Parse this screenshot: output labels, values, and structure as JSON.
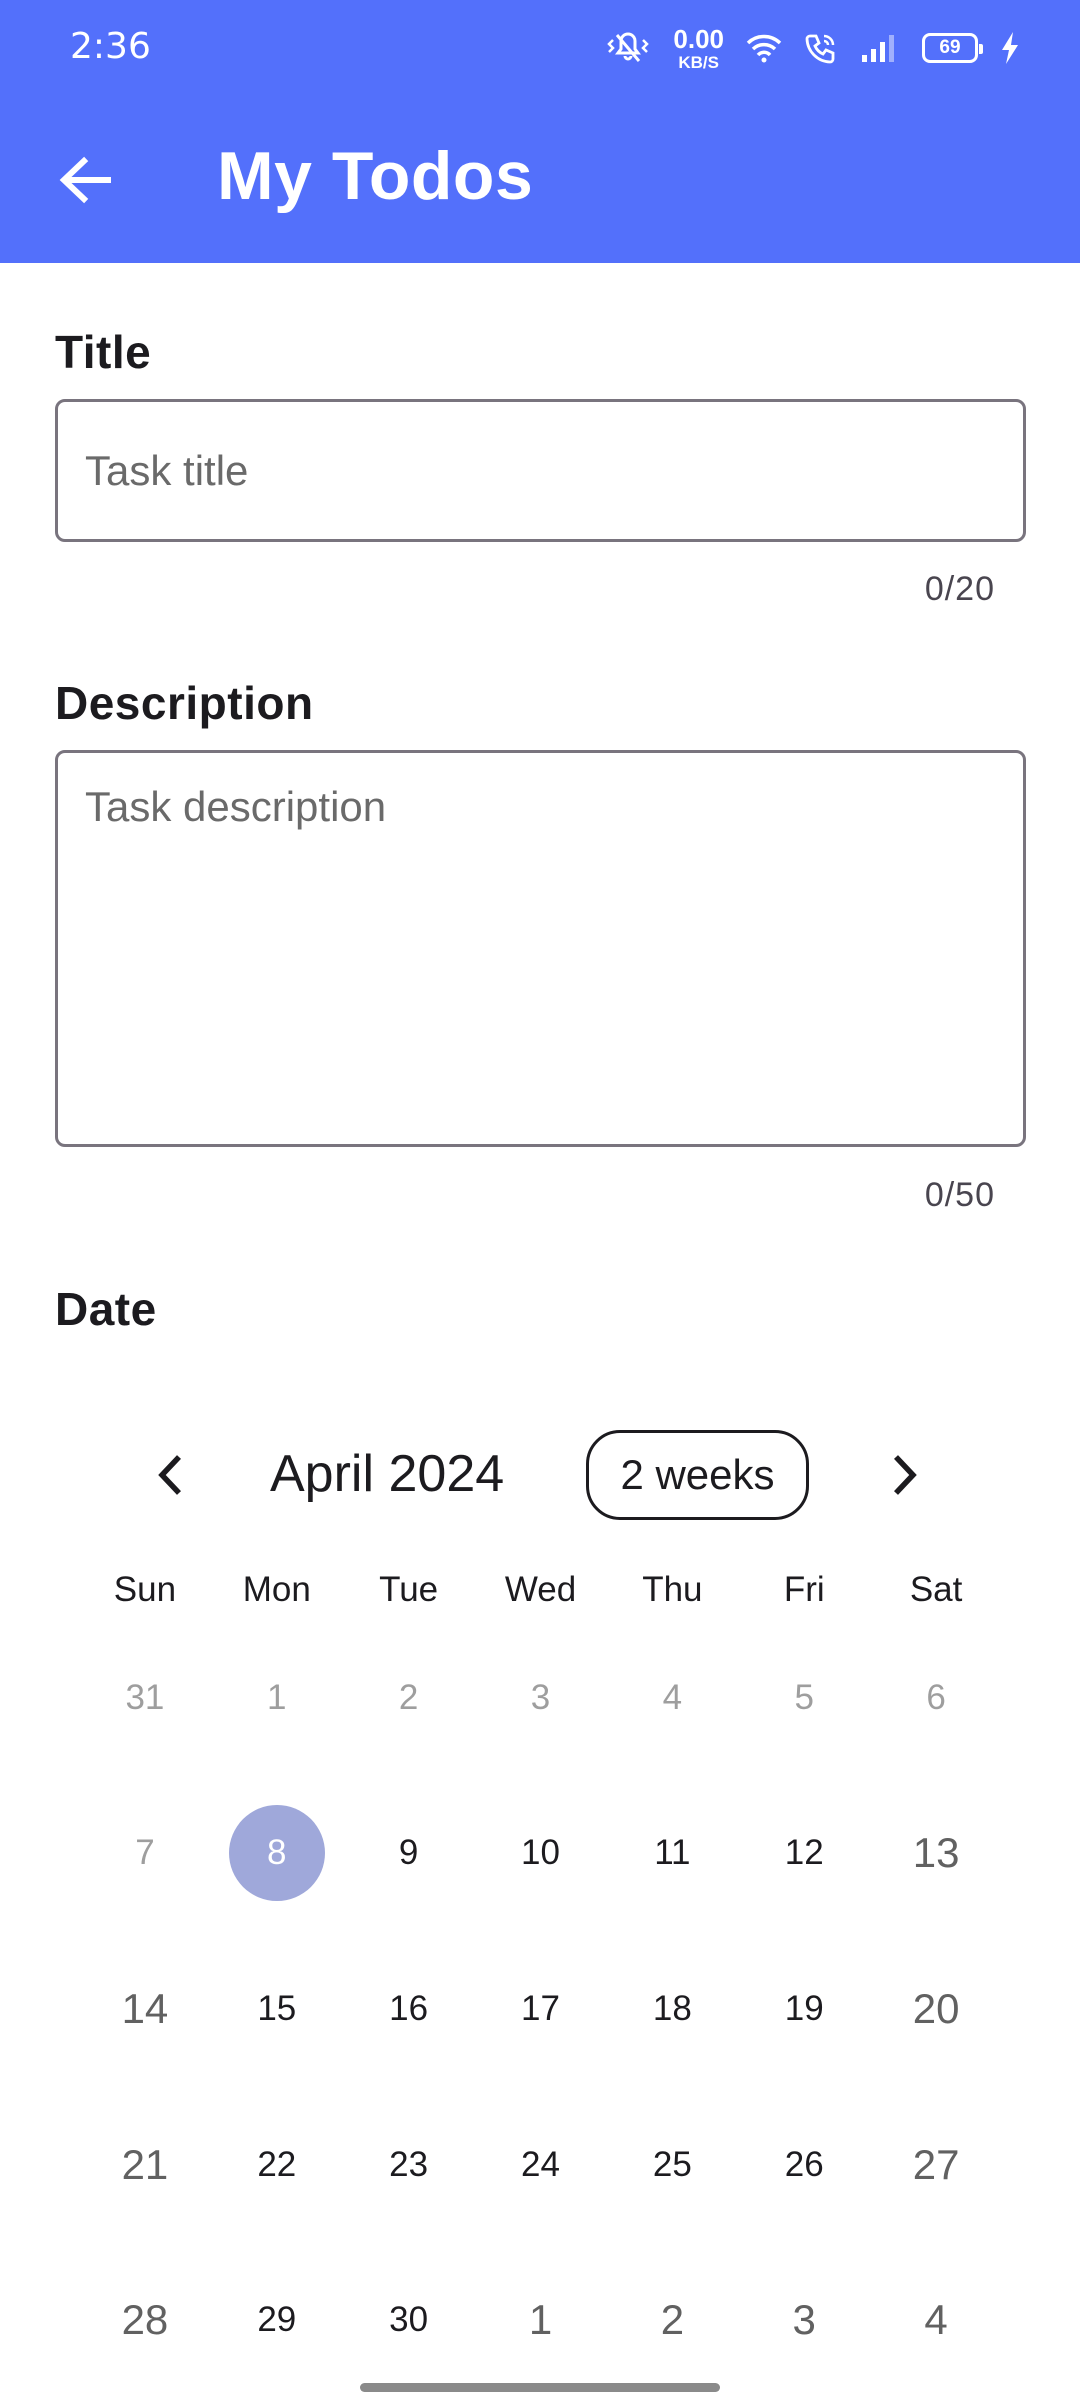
{
  "status_bar": {
    "time": "2:36",
    "net_speed_value": "0.00",
    "net_speed_unit": "KB/S",
    "battery": "69",
    "icons": [
      "vibrate-icon",
      "wifi-icon",
      "wifi-call-icon",
      "signal-icon",
      "battery-icon",
      "charging-icon"
    ]
  },
  "app_bar": {
    "title": "My Todos",
    "back_icon": "arrow-back-icon",
    "background": "#5370fb"
  },
  "form": {
    "title_label": "Title",
    "title_placeholder": "Task title",
    "title_value": "",
    "title_counter": "0/20",
    "description_label": "Description",
    "description_placeholder": "Task description",
    "description_value": "",
    "description_counter": "0/50",
    "date_label": "Date"
  },
  "calendar": {
    "month_label": "April 2024",
    "format_button": "2 weeks",
    "prev_icon": "chevron-left-icon",
    "next_icon": "chevron-right-icon",
    "weekdays": [
      "Sun",
      "Mon",
      "Tue",
      "Wed",
      "Thu",
      "Fri",
      "Sat"
    ],
    "weeks": [
      [
        "31",
        "1",
        "2",
        "3",
        "4",
        "5",
        "6"
      ],
      [
        "7",
        "8",
        "9",
        "10",
        "11",
        "12",
        "13"
      ],
      [
        "14",
        "15",
        "16",
        "17",
        "18",
        "19",
        "20"
      ],
      [
        "21",
        "22",
        "23",
        "24",
        "25",
        "26",
        "27"
      ],
      [
        "28",
        "29",
        "30",
        "1",
        "2",
        "3",
        "4"
      ]
    ],
    "selected_day": "8",
    "selected_color": "#9fa8da"
  }
}
